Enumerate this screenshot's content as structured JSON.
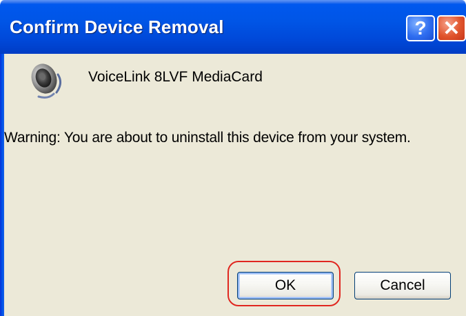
{
  "window": {
    "title": "Confirm Device Removal",
    "help_button_glyph": "?",
    "close_button_glyph": "✕"
  },
  "content": {
    "device_icon": "speaker-icon",
    "device_name": "VoiceLink 8LVF MediaCard",
    "warning_text": "Warning: You are about to uninstall this device from your system."
  },
  "buttons": {
    "ok_label": "OK",
    "cancel_label": "Cancel"
  },
  "colors": {
    "titlebar": "#0055e6",
    "client_background": "#ece9d8",
    "highlight": "#e0261f"
  }
}
